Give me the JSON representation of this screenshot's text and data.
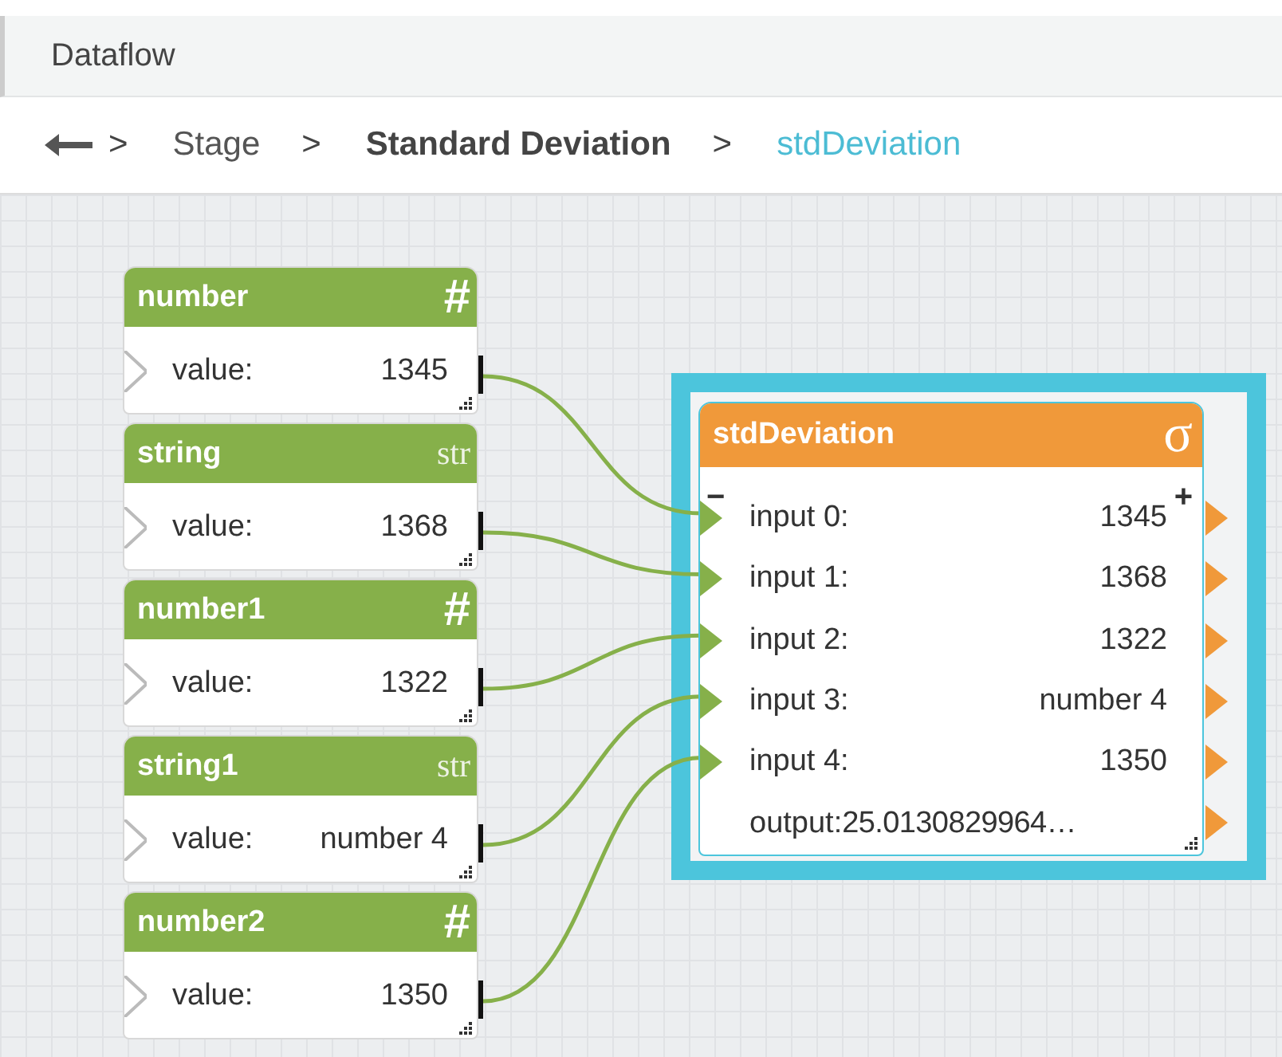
{
  "panel": {
    "title": "Dataflow"
  },
  "breadcrumb": [
    {
      "label": "Stage",
      "kind": "plain"
    },
    {
      "label": "Standard Deviation",
      "kind": "strong"
    },
    {
      "label": "stdDeviation",
      "kind": "active"
    }
  ],
  "separator": ">",
  "source_nodes": [
    {
      "title": "number",
      "icon": "#",
      "kind": "number",
      "label": "value:",
      "value": "1345",
      "selected": false
    },
    {
      "title": "string",
      "icon": "str",
      "kind": "string",
      "label": "value:",
      "value": "1368",
      "selected": false
    },
    {
      "title": "number1",
      "icon": "#",
      "kind": "number",
      "label": "value:",
      "value": "1322",
      "selected": false
    },
    {
      "title": "string1",
      "icon": "str",
      "kind": "string",
      "label": "value:",
      "value": "number 4",
      "selected": false
    },
    {
      "title": "number2",
      "icon": "#",
      "kind": "number",
      "label": "value:",
      "value": "1350",
      "selected": false
    }
  ],
  "target_node": {
    "title": "stdDeviation",
    "icon": "σ",
    "selected": true,
    "remove": "−",
    "add": "+",
    "inputs": [
      {
        "label": "input 0:",
        "value": "1345"
      },
      {
        "label": "input 1:",
        "value": "1368"
      },
      {
        "label": "input 2:",
        "value": "1322"
      },
      {
        "label": "input 3:",
        "value": "number 4"
      },
      {
        "label": "input 4:",
        "value": "1350"
      }
    ],
    "output": {
      "label": "output:",
      "value": "25.0130829964…"
    }
  }
}
